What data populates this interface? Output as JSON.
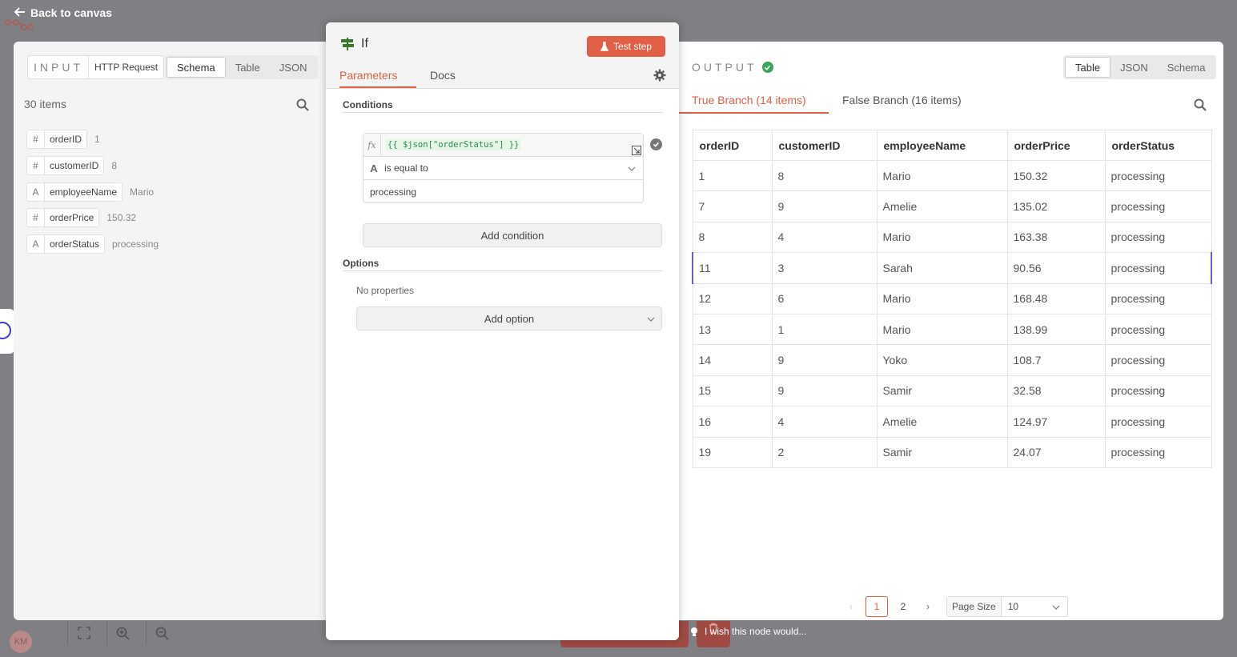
{
  "topbar": {
    "back_label": "Back to canvas"
  },
  "colors": {
    "accent": "#e05f46",
    "success": "#3aa55d",
    "selection": "#6b5bd0",
    "backdrop": "#7f7f84"
  },
  "input": {
    "title": "INPUT",
    "source": "HTTP Request",
    "view_options": [
      "Schema",
      "Table",
      "JSON"
    ],
    "active_view": "Schema",
    "items_count": "30 items",
    "fields": [
      {
        "type": "#",
        "name": "orderID",
        "value": "1"
      },
      {
        "type": "#",
        "name": "customerID",
        "value": "8"
      },
      {
        "type": "A",
        "name": "employeeName",
        "value": "Mario"
      },
      {
        "type": "#",
        "name": "orderPrice",
        "value": "150.32"
      },
      {
        "type": "A",
        "name": "orderStatus",
        "value": "processing"
      }
    ]
  },
  "node": {
    "title": "If",
    "test_button": "Test step",
    "tabs": [
      "Parameters",
      "Docs"
    ],
    "active_tab": "Parameters",
    "conditions_label": "Conditions",
    "condition": {
      "fx": "fx",
      "expression": "{{ $json[\"orderStatus\"] }}",
      "type_glyph": "A",
      "operator": "is equal to",
      "value": "processing"
    },
    "add_condition": "Add condition",
    "options_label": "Options",
    "no_properties": "No properties",
    "add_option": "Add option"
  },
  "output": {
    "title": "OUTPUT",
    "view_options": [
      "Table",
      "JSON",
      "Schema"
    ],
    "active_view": "Table",
    "branches": [
      "True Branch (14 items)",
      "False Branch (16 items)"
    ],
    "active_branch": "True Branch (14 items)",
    "columns": [
      "orderID",
      "customerID",
      "employeeName",
      "orderPrice",
      "orderStatus"
    ],
    "rows": [
      [
        "1",
        "8",
        "Mario",
        "150.32",
        "processing"
      ],
      [
        "7",
        "9",
        "Amelie",
        "135.02",
        "processing"
      ],
      [
        "8",
        "4",
        "Mario",
        "163.38",
        "processing"
      ],
      [
        "11",
        "3",
        "Sarah",
        "90.56",
        "processing"
      ],
      [
        "12",
        "6",
        "Mario",
        "168.48",
        "processing"
      ],
      [
        "13",
        "1",
        "Mario",
        "138.99",
        "processing"
      ],
      [
        "14",
        "9",
        "Yoko",
        "108.7",
        "processing"
      ],
      [
        "15",
        "9",
        "Samir",
        "32.58",
        "processing"
      ],
      [
        "16",
        "4",
        "Amelie",
        "124.97",
        "processing"
      ],
      [
        "19",
        "2",
        "Samir",
        "24.07",
        "processing"
      ]
    ],
    "selected_row": 3,
    "pagination": {
      "pages": [
        "1",
        "2"
      ],
      "current": "1",
      "page_size_label": "Page Size",
      "page_size": "10"
    }
  },
  "footer": {
    "avatar_initials": "KM",
    "feedback": "I wish this node would..."
  }
}
